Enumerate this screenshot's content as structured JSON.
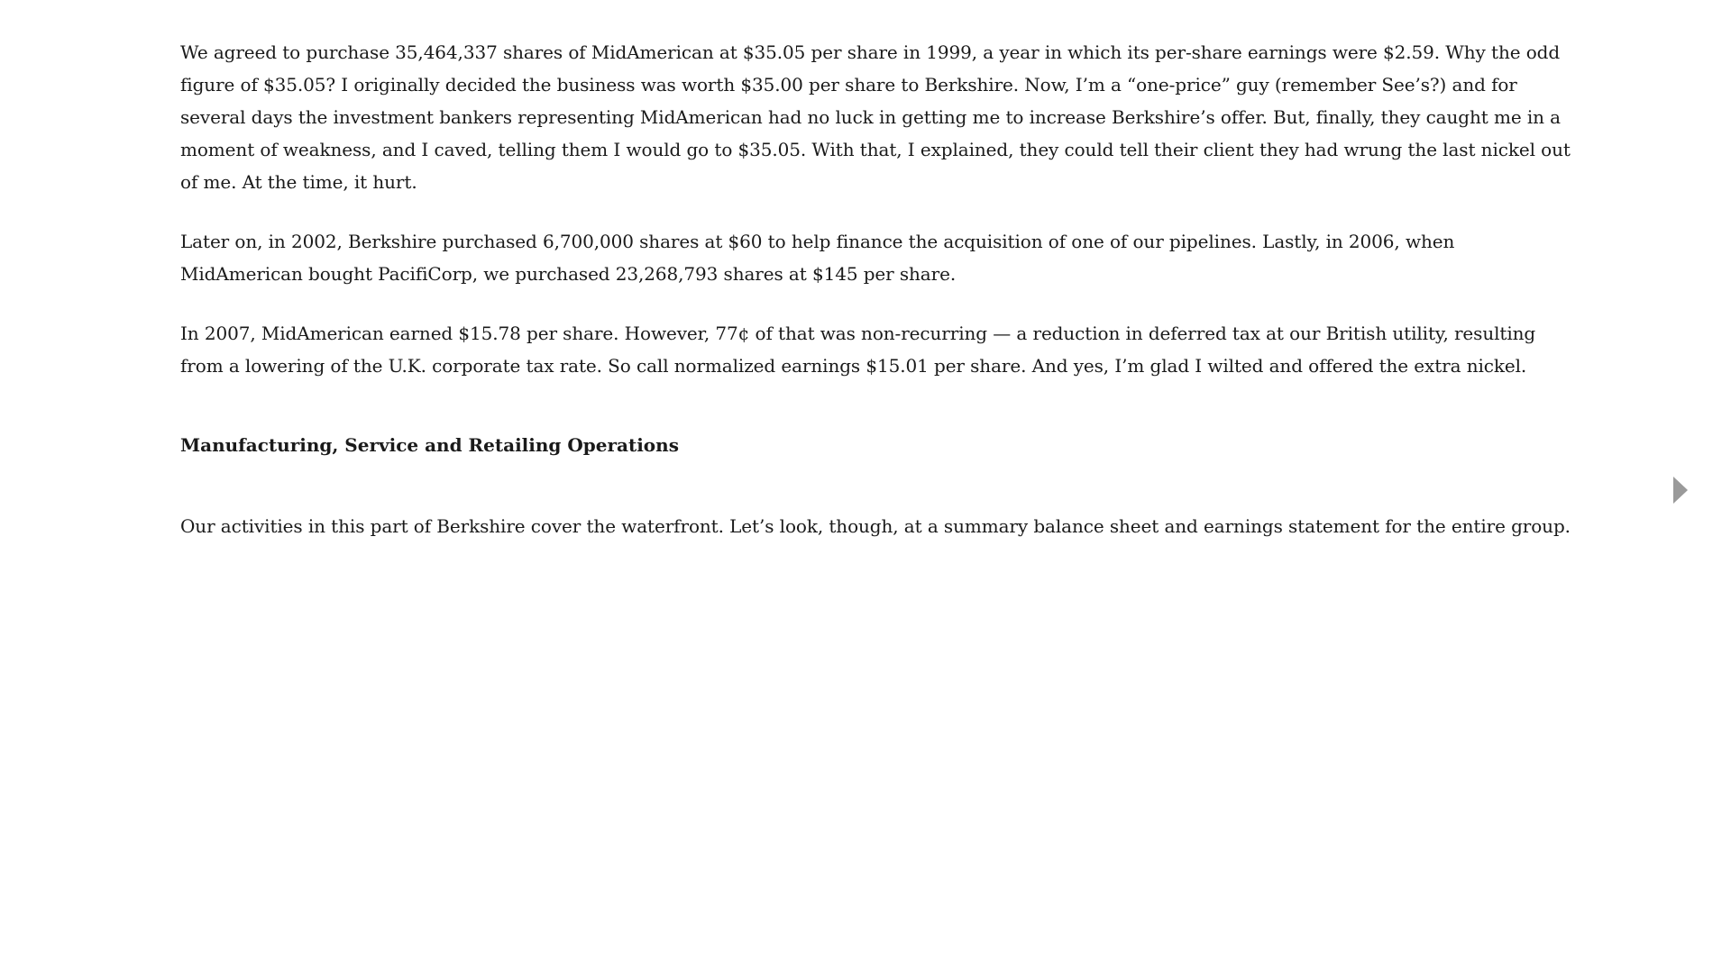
{
  "document": {
    "paragraphs": [
      "We agreed to purchase 35,464,337 shares of MidAmerican at $35.05 per share in 1999, a year in which its per-share earnings were $2.59. Why the odd figure of $35.05? I originally decided the business was worth $35.00 per share to Berkshire. Now, I’m a “one-price” guy (remember See’s?) and for several days the investment bankers representing MidAmerican had no luck in getting me to increase Berkshire’s offer. But, finally, they caught me in a moment of weakness, and I caved, telling them I would go to $35.05. With that, I explained, they could tell their client they had wrung the last nickel out of me. At the time, it hurt.",
      "Later on, in 2002, Berkshire purchased 6,700,000 shares at $60 to help finance the acquisition of one of our pipelines. Lastly, in 2006, when MidAmerican bought PacifiCorp, we purchased 23,268,793 shares at $145 per share.",
      "In 2007, MidAmerican earned $15.78 per share. However, 77¢ of that was non-recurring — a reduction in deferred tax at our British utility, resulting from a lowering of the U.K. corporate tax rate. So call normalized earnings $15.01 per share. And yes, I’m glad I wilted and offered the extra nickel."
    ],
    "section_heading": "Manufacturing, Service and Retailing Operations",
    "section_paragraph": "Our activities in this part of Berkshire cover the waterfront. Let’s look, though, at a summary balance sheet and earnings statement for the entire group."
  },
  "navigation": {
    "next_icon": "triangle-right-icon",
    "arrow_color": "#9a9a9a"
  }
}
